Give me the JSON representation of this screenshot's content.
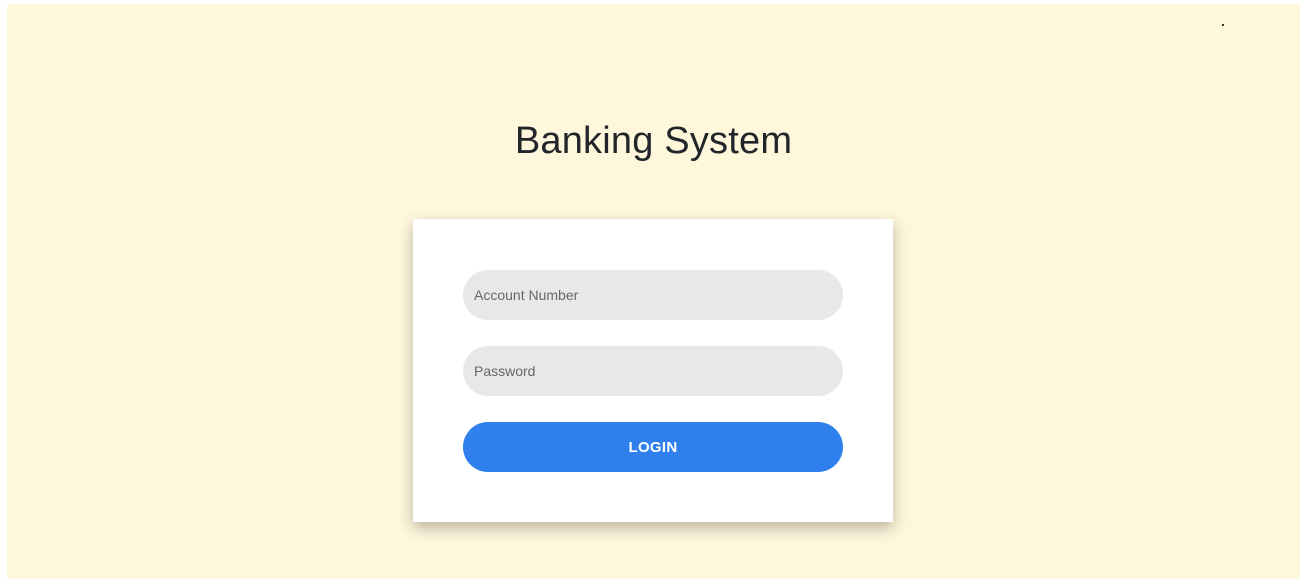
{
  "app": {
    "title": "Banking System"
  },
  "login_form": {
    "account_number": {
      "placeholder": "Account Number",
      "value": ""
    },
    "password": {
      "placeholder": "Password",
      "value": ""
    },
    "login_label": "LOGIN"
  },
  "colors": {
    "background": "#fff7dc",
    "card": "#ffffff",
    "input_background": "#e8e8e8",
    "accent": "#2f80ed",
    "title_text": "#22262a"
  }
}
